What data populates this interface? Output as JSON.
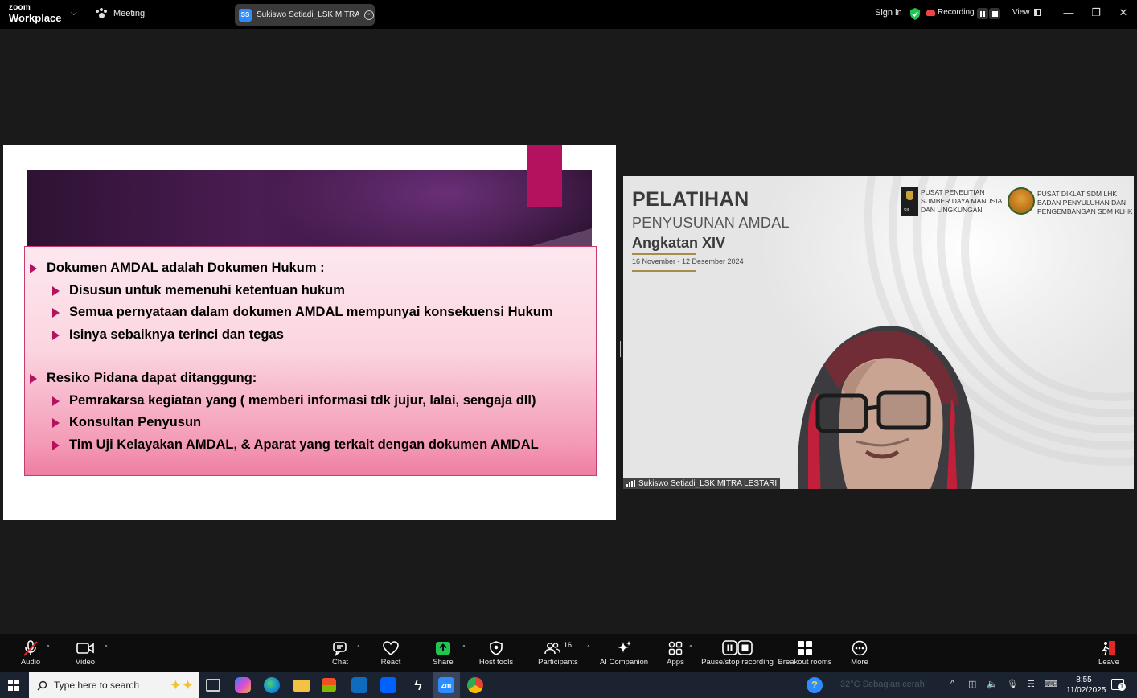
{
  "titlebar": {
    "brand_top": "zoom",
    "brand_bottom": "Workplace",
    "meeting_label": "Meeting",
    "tab_initials": "SS",
    "tab_title": "Sukiswo Setiadi_LSK MITRA LESTA",
    "signin": "Sign in",
    "recording": "Recording...",
    "view": "View"
  },
  "slide": {
    "bullets": [
      {
        "level": 1,
        "text": "Dokumen AMDAL adalah Dokumen Hukum :"
      },
      {
        "level": 2,
        "text": "Disusun untuk memenuhi ketentuan hukum"
      },
      {
        "level": 2,
        "text": "Semua pernyataan dalam dokumen AMDAL mempunyai konsekuensi Hukum"
      },
      {
        "level": 2,
        "text": "Isinya sebaiknya terinci dan tegas"
      },
      {
        "level": 1,
        "text": "Resiko Pidana dapat ditanggung:"
      },
      {
        "level": 2,
        "text": "Pemrakarsa kegiatan yang ( memberi informasi tdk jujur, lalai, sengaja dll)"
      },
      {
        "level": 2,
        "text": "Konsultan Penyusun"
      },
      {
        "level": 2,
        "text": "Tim Uji Kelayakan AMDAL, & Aparat yang terkait dengan dokumen AMDAL"
      }
    ]
  },
  "video": {
    "title1": "PELATIHAN",
    "title2": "PENYUSUNAN AMDAL",
    "title3": "Angkatan XIV",
    "dates": "16 November - 12 Desember 2024",
    "logo1_text": "PUSAT PENELITIAN\nSUMBER DAYA MANUSIA\nDAN LINGKUNGAN",
    "logo1_sub": "SIL",
    "logo2_text": "PUSAT DIKLAT SDM LHK\nBADAN PENYULUHAN DAN\nPENGEMBANGAN SDM KLHK",
    "participant_name": "Sukiswo Setiadi_LSK MITRA LESTARI"
  },
  "toolbar": {
    "audio": "Audio",
    "video": "Video",
    "chat": "Chat",
    "react": "React",
    "share": "Share",
    "host_tools": "Host tools",
    "participants": "Participants",
    "participants_count": "16",
    "ai_companion": "AI Companion",
    "apps": "Apps",
    "pause_stop": "Pause/stop recording",
    "breakout": "Breakout rooms",
    "more": "More",
    "leave": "Leave"
  },
  "taskbar": {
    "search_placeholder": "Type here to search",
    "weather": "32°C  Sebagian cerah",
    "time": "8:55",
    "date": "11/02/2025",
    "notif_count": "1"
  },
  "colors": {
    "accent_magenta": "#b4125f",
    "zoom_blue": "#2d8cff",
    "share_green": "#23c552",
    "leave_red": "#e02828"
  }
}
